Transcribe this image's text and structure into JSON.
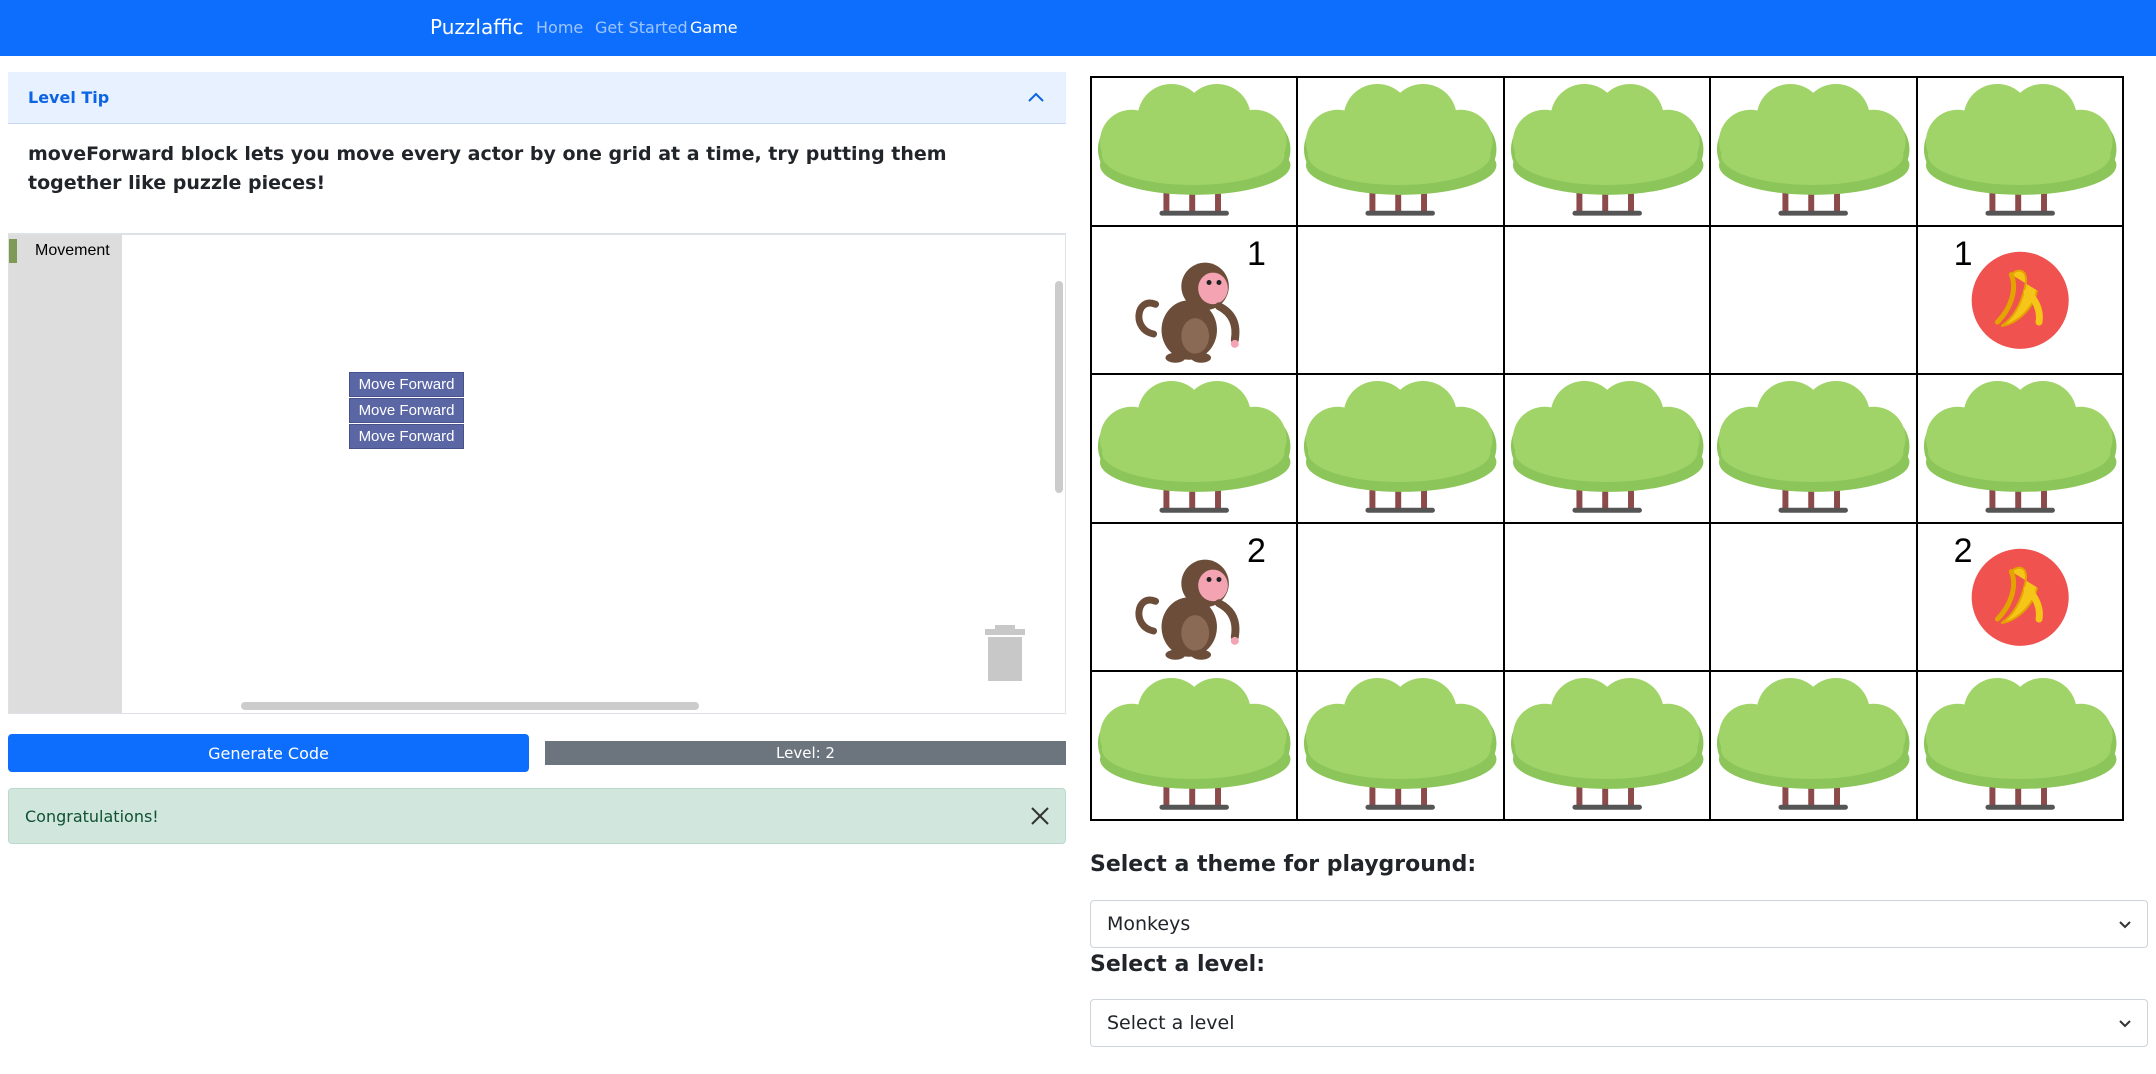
{
  "nav": {
    "brand": "Puzzlaffic",
    "links": [
      {
        "label": "Home",
        "active": false
      },
      {
        "label": "Get Started",
        "active": false
      },
      {
        "label": "Game",
        "active": true
      }
    ]
  },
  "level_tip": {
    "title": "Level Tip",
    "body": "moveForward block lets you move every actor by one grid at a time, try putting them together like puzzle pieces!"
  },
  "workspace": {
    "toolbox_category": "Movement",
    "blocks": [
      "Move Forward",
      "Move Forward",
      "Move Forward"
    ]
  },
  "actions": {
    "generate_label": "Generate Code",
    "level_text": "Level: 2"
  },
  "alert": {
    "message": "Congratulations!"
  },
  "board": {
    "rows": [
      [
        {
          "type": "tree"
        },
        {
          "type": "tree"
        },
        {
          "type": "tree"
        },
        {
          "type": "tree"
        },
        {
          "type": "tree"
        }
      ],
      [
        {
          "type": "monkey",
          "label": "1"
        },
        {
          "type": "empty"
        },
        {
          "type": "empty"
        },
        {
          "type": "empty"
        },
        {
          "type": "banana",
          "label": "1"
        }
      ],
      [
        {
          "type": "tree"
        },
        {
          "type": "tree"
        },
        {
          "type": "tree"
        },
        {
          "type": "tree"
        },
        {
          "type": "tree"
        }
      ],
      [
        {
          "type": "monkey",
          "label": "2"
        },
        {
          "type": "empty"
        },
        {
          "type": "empty"
        },
        {
          "type": "empty"
        },
        {
          "type": "banana",
          "label": "2"
        }
      ],
      [
        {
          "type": "tree"
        },
        {
          "type": "tree"
        },
        {
          "type": "tree"
        },
        {
          "type": "tree"
        },
        {
          "type": "tree"
        }
      ]
    ]
  },
  "theme": {
    "label": "Select a theme for playground:",
    "selected": "Monkeys"
  },
  "level_select": {
    "label": "Select a level:",
    "selected": "Select a level"
  },
  "colors": {
    "primary": "#0d6efd",
    "block": "#5b67a5",
    "tree": "#a0d468",
    "banana_bg": "#f0524f",
    "alert_bg": "#d1e7dd"
  }
}
